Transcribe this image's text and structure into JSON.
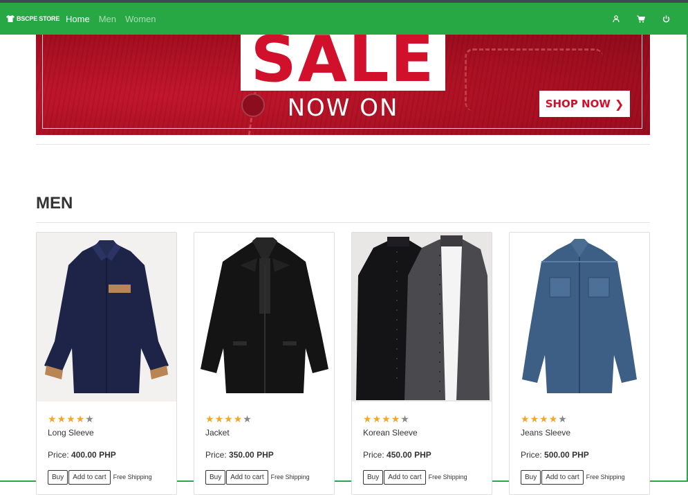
{
  "navbar": {
    "brand": "BSCPE STORE",
    "links": [
      "Home",
      "Men",
      "Women"
    ],
    "icons": [
      "user-icon",
      "cart-icon",
      "power-icon"
    ],
    "color": "#28a745"
  },
  "banner": {
    "sale": "SALE",
    "now_on": "NOW ON",
    "shop_now": "SHOP NOW"
  },
  "section": {
    "title": "MEN"
  },
  "products": [
    {
      "name": "Long Sleeve",
      "price_label": "Price:",
      "price": "400.00 PHP",
      "rating": 4,
      "buy": "Buy",
      "add": "Add to cart",
      "shipping": "Free Shipping"
    },
    {
      "name": "Jacket",
      "price_label": "Price:",
      "price": "350.00 PHP",
      "rating": 4,
      "buy": "Buy",
      "add": "Add to cart",
      "shipping": "Free Shipping"
    },
    {
      "name": "Korean Sleeve",
      "price_label": "Price:",
      "price": "450.00 PHP",
      "rating": 4,
      "buy": "Buy",
      "add": "Add to cart",
      "shipping": "Free Shipping"
    },
    {
      "name": "Jeans Sleeve",
      "price_label": "Price:",
      "price": "500.00 PHP",
      "rating": 4,
      "buy": "Buy",
      "add": "Add to cart",
      "shipping": "Free Shipping"
    }
  ]
}
